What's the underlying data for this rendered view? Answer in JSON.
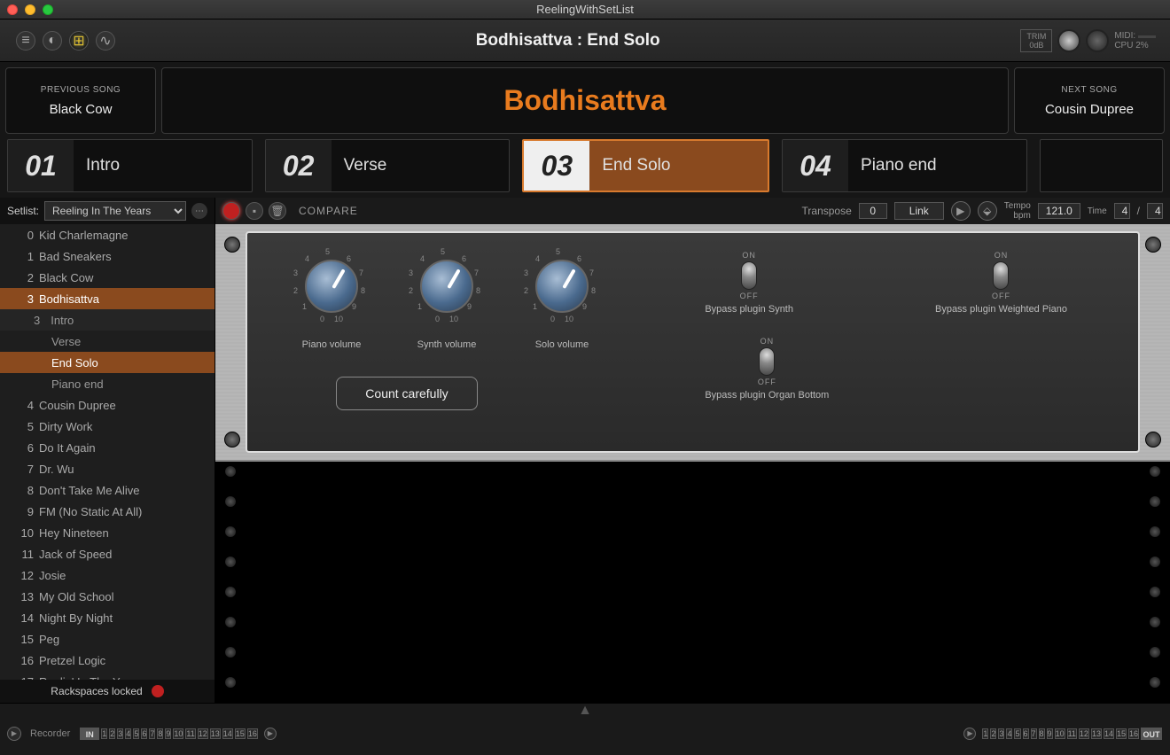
{
  "window": {
    "title": "ReelingWithSetList"
  },
  "header": {
    "title": "Bodhisattva : End Solo",
    "trim_label": "TRIM",
    "trim_value": "0dB",
    "midi_label": "MIDI:",
    "cpu_label": "CPU",
    "cpu_value": "2%"
  },
  "nav": {
    "prev_label": "PREVIOUS SONG",
    "prev_song": "Black Cow",
    "next_label": "NEXT SONG",
    "next_song": "Cousin Dupree",
    "current_song": "Bodhisattva"
  },
  "parts": [
    {
      "num": "01",
      "name": "Intro",
      "selected": false
    },
    {
      "num": "02",
      "name": "Verse",
      "selected": false
    },
    {
      "num": "03",
      "name": "End Solo",
      "selected": true
    },
    {
      "num": "04",
      "name": "Piano end",
      "selected": false
    }
  ],
  "toolbar": {
    "compare": "COMPARE",
    "transpose_label": "Transpose",
    "transpose_value": "0",
    "link": "Link",
    "tempo_label": "Tempo",
    "bpm_label": "bpm",
    "bpm_value": "121.0",
    "time_label": "Time",
    "time_num": "4",
    "time_denom": "4"
  },
  "setlist": {
    "label": "Setlist:",
    "name": "Reeling In The Years",
    "songs": [
      {
        "n": "0",
        "name": "Kid Charlemagne"
      },
      {
        "n": "1",
        "name": "Bad Sneakers"
      },
      {
        "n": "2",
        "name": "Black Cow"
      },
      {
        "n": "3",
        "name": "Bodhisattva",
        "sel": true,
        "subs": [
          {
            "n": "3",
            "name": "Intro"
          },
          {
            "name": "Verse"
          },
          {
            "name": "End Solo",
            "sel": true
          },
          {
            "name": "Piano end"
          }
        ]
      },
      {
        "n": "4",
        "name": "Cousin Dupree"
      },
      {
        "n": "5",
        "name": "Dirty Work"
      },
      {
        "n": "6",
        "name": "Do It Again"
      },
      {
        "n": "7",
        "name": "Dr. Wu"
      },
      {
        "n": "8",
        "name": "Don't Take Me Alive"
      },
      {
        "n": "9",
        "name": "FM (No Static At All)"
      },
      {
        "n": "10",
        "name": "Hey Nineteen"
      },
      {
        "n": "11",
        "name": "Jack of Speed"
      },
      {
        "n": "12",
        "name": "Josie"
      },
      {
        "n": "13",
        "name": "My Old School"
      },
      {
        "n": "14",
        "name": "Night By Night"
      },
      {
        "n": "15",
        "name": "Peg"
      },
      {
        "n": "16",
        "name": "Pretzel Logic"
      },
      {
        "n": "17",
        "name": "Reelin' In The Years"
      }
    ],
    "footer": "Rackspaces locked"
  },
  "rack": {
    "knobs": [
      {
        "label": "Piano volume"
      },
      {
        "label": "Synth volume"
      },
      {
        "label": "Solo volume"
      }
    ],
    "switches": [
      {
        "label": "Bypass plugin Synth"
      },
      {
        "label": "Bypass plugin Weighted Piano"
      },
      {
        "label": "Bypass plugin Organ Bottom"
      }
    ],
    "on": "ON",
    "off": "OFF",
    "note": "Count carefully"
  },
  "footer": {
    "recorder": "Recorder",
    "in": "IN",
    "out": "OUT",
    "channels": [
      "1",
      "2",
      "3",
      "4",
      "5",
      "6",
      "7",
      "8",
      "9",
      "10",
      "11",
      "12",
      "13",
      "14",
      "15",
      "16"
    ]
  }
}
